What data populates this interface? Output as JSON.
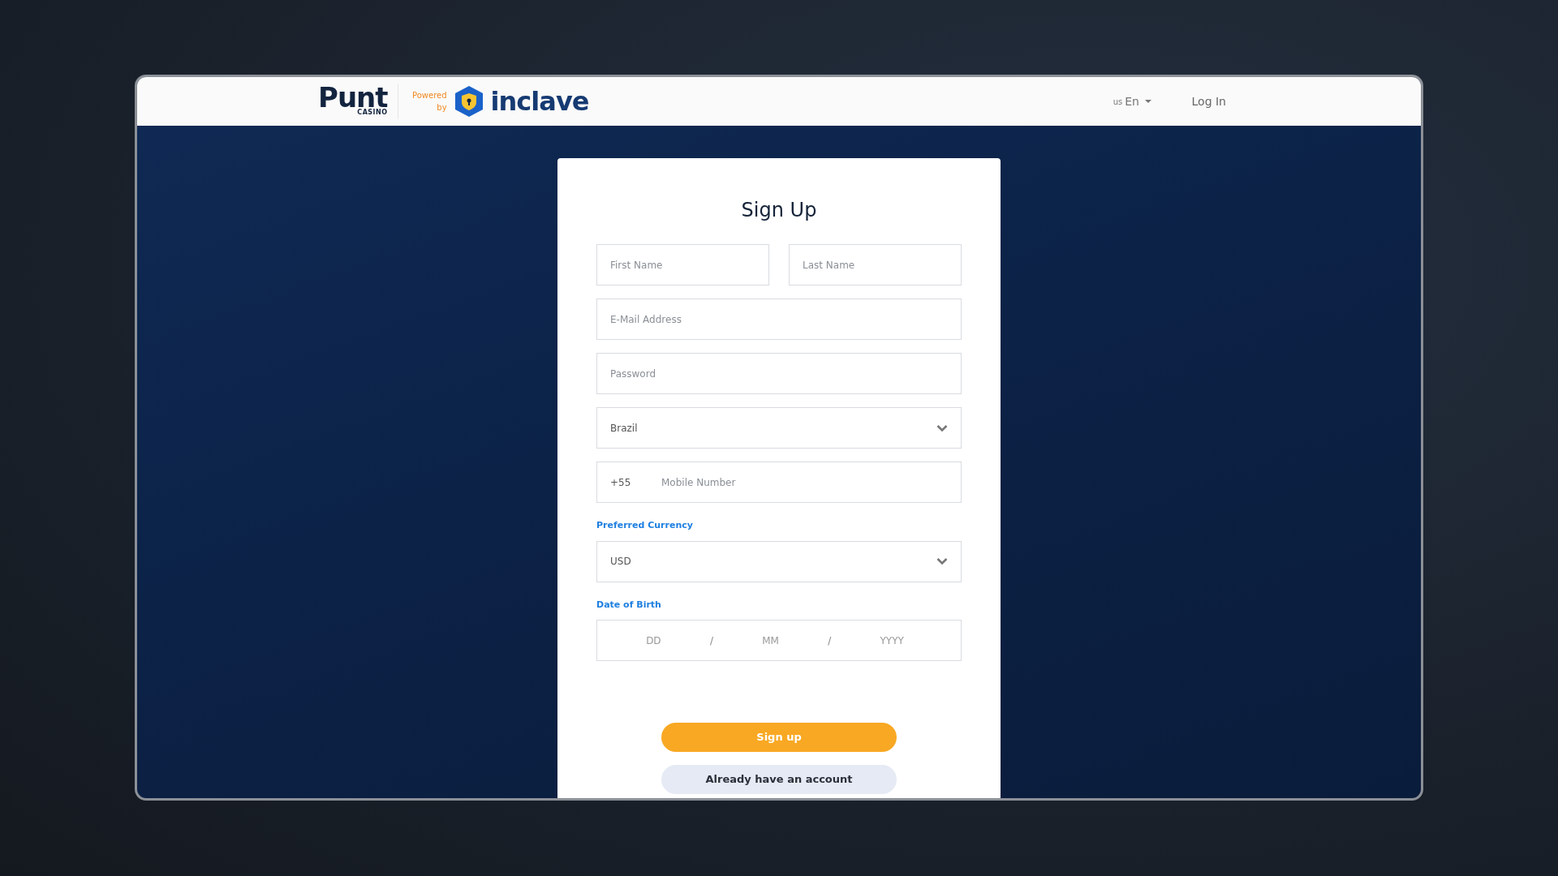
{
  "header": {
    "logo": {
      "brand": "Punt",
      "sub": "CASINO"
    },
    "powered_by": "Powered by",
    "partner": "inclave",
    "language": {
      "region": "us",
      "label": "En"
    },
    "login": "Log In"
  },
  "form": {
    "title": "Sign Up",
    "rows": [
      {
        "kind": "pair",
        "fields": [
          {
            "placeholder": "First Name"
          },
          {
            "placeholder": "Last Name"
          }
        ]
      },
      {
        "kind": "text",
        "placeholder": "E-Mail Address"
      },
      {
        "kind": "password",
        "placeholder": "Password"
      },
      {
        "kind": "select",
        "value": "Brazil"
      },
      {
        "kind": "phone",
        "prefix": "+55",
        "placeholder": "Mobile Number"
      },
      {
        "kind": "select",
        "label": "Preferred Currency",
        "value": "USD"
      },
      {
        "kind": "date",
        "label": "Date of Birth",
        "parts": [
          "DD",
          "MM",
          "YYYY"
        ],
        "separator": "/"
      }
    ],
    "buttons": [
      {
        "kind": "primary",
        "label": "Sign up"
      },
      {
        "kind": "secondary",
        "label": "Already have an account"
      }
    ]
  }
}
